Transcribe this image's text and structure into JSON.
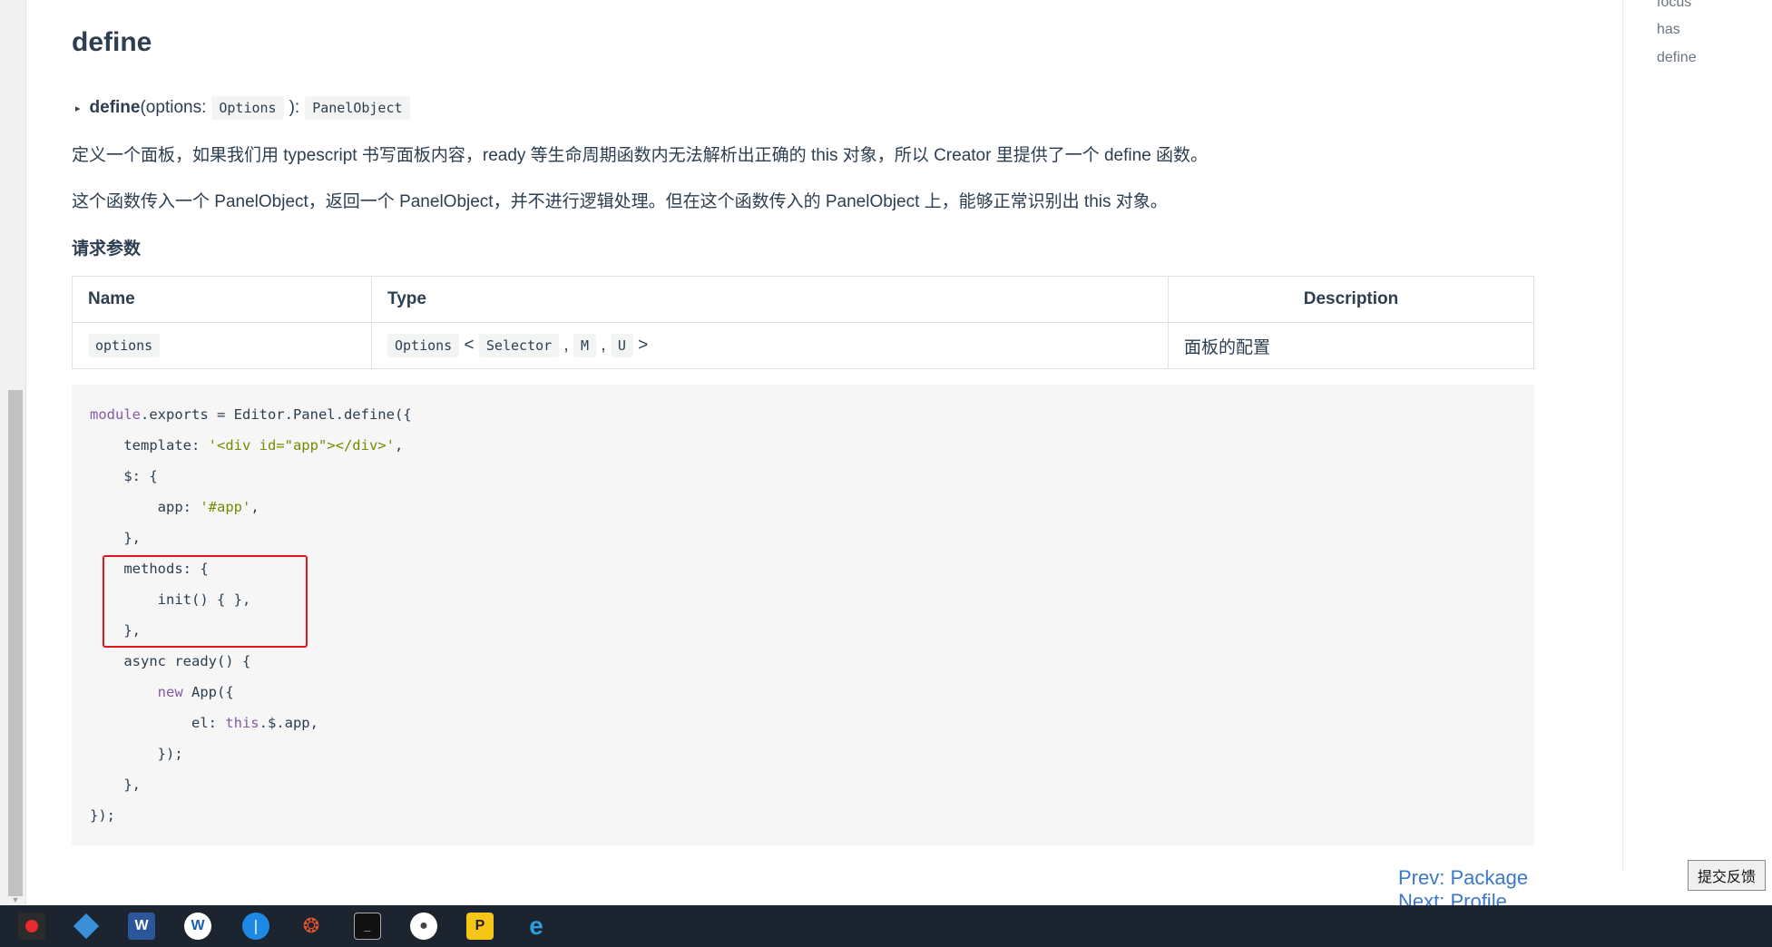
{
  "heading": "define",
  "signature": {
    "fname": "define",
    "open": "(options: ",
    "param_type": "Options",
    "close": "): ",
    "return_type": "PanelObject"
  },
  "paragraphs": [
    "定义一个面板，如果我们用 typescript 书写面板内容，ready 等生命周期函数内无法解析出正确的 this 对象，所以 Creator 里提供了一个 define 函数。",
    "这个函数传入一个 PanelObject，返回一个 PanelObject，并不进行逻辑处理。但在这个函数传入的 PanelObject 上，能够正常识别出 this 对象。"
  ],
  "params_heading": "请求参数",
  "table": {
    "headers": [
      "Name",
      "Type",
      "Description"
    ],
    "row": {
      "name": "options",
      "type_parts": [
        "Options",
        "Selector",
        "M",
        "U"
      ],
      "type_lt": "<",
      "type_gt": ">",
      "comma": ",",
      "description": "面板的配置"
    }
  },
  "code": {
    "line1_kw": "module",
    "line1_rest": ".exports = Editor.Panel.define({",
    "line2_a": "    template: ",
    "line2_str": "'<div id=\"app\"></div>'",
    "line2_b": ",",
    "line3": "    $: {",
    "line4_a": "        app: ",
    "line4_str": "'#app'",
    "line4_b": ",",
    "line5": "    },",
    "line6": "    methods: {",
    "line7": "        init() { },",
    "line8": "    },",
    "line9": "    async ready() {",
    "line10_a": "        ",
    "line10_kw": "new",
    "line10_b": " App({",
    "line11_a": "            el: ",
    "line11_kw": "this",
    "line11_b": ".$.app,",
    "line12": "        });",
    "line13": "    },",
    "line14": "});"
  },
  "toc": [
    "focus",
    "has",
    "define"
  ],
  "nav": {
    "prev": "Prev: Package",
    "next": "Next: Profile"
  },
  "feedback_label": "提交反馈",
  "taskbar_icons": [
    "record-app",
    "git-tool",
    "word",
    "browser-w",
    "feather-app",
    "swirl-app",
    "terminal",
    "droplet-app",
    "chat-app",
    "ie-browser"
  ],
  "colors": {
    "accent": "#3c78c8",
    "highlight_box": "#e0161f",
    "taskbar": "#1c2430"
  }
}
